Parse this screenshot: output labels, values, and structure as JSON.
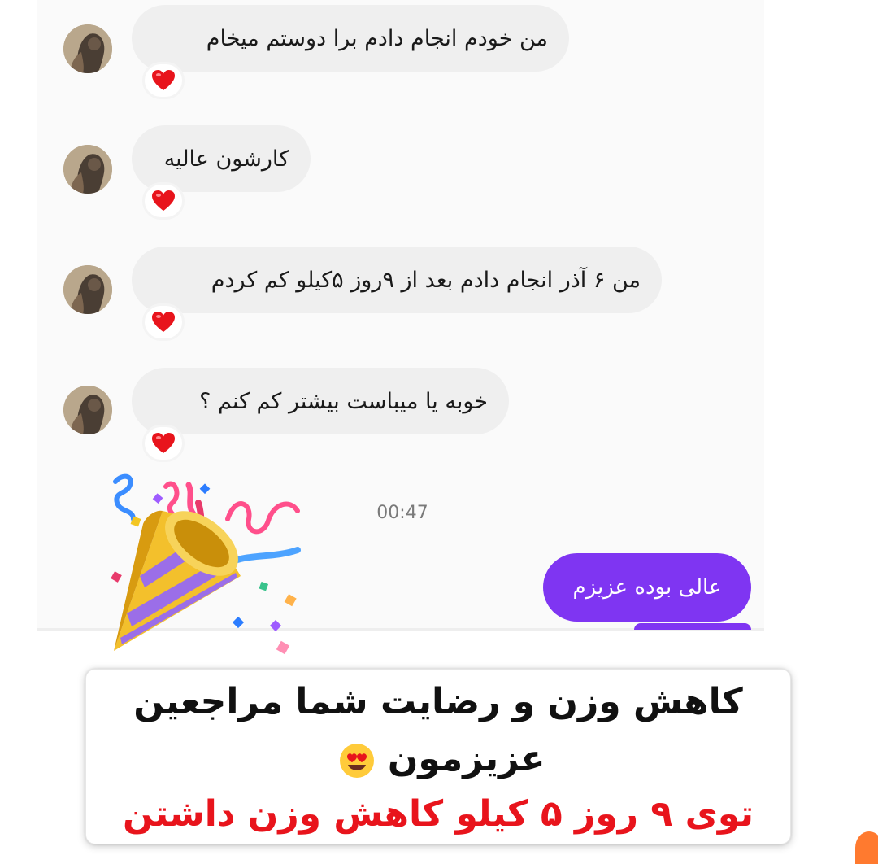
{
  "messages": [
    {
      "text": "من خودم انجام دادم برا دوستم میخام",
      "reaction": "heart"
    },
    {
      "text": "کارشون عالیه",
      "reaction": "heart"
    },
    {
      "text": "من ۶ آذر انجام دادم بعد از ۹روز ۵کیلو کم کردم",
      "reaction": "heart"
    },
    {
      "text": "خوبه یا میباست بیشتر کم کنم ؟",
      "reaction": "heart"
    }
  ],
  "timestamp": "00:47",
  "reply": {
    "text": "عالی بوده عزیزم"
  },
  "caption": {
    "line1": "کاهش وزن و رضایت شما مراجعین",
    "line2": "عزیزمون",
    "line3": "توی ۹ روز ۵ کیلو کاهش وزن داشتن"
  },
  "colors": {
    "sent_bubble": "#7f35f2",
    "received_bubble": "#efefef",
    "caption_highlight": "#e8141c",
    "reaction_heart": "#e8141c"
  },
  "icons": [
    "party-popper-icon",
    "heart-icon",
    "heart-eyes-emoji-icon",
    "avatar"
  ]
}
